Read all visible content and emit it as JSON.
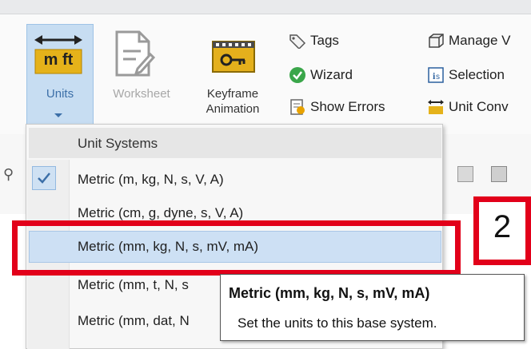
{
  "ribbon": {
    "units_label": "Units",
    "worksheet_label": "Worksheet",
    "keyframe_label_line1": "Keyframe",
    "keyframe_label_line2": "Animation",
    "units_icon_text": "m ft",
    "col2": {
      "tags": "Tags",
      "wizard": "Wizard",
      "show_errors": "Show Errors"
    },
    "col3": {
      "manage": "Manage V",
      "selection": "Selection",
      "unit_conv": "Unit Conv"
    }
  },
  "menu": {
    "header": "Unit Systems",
    "items": [
      {
        "label": "Metric (m, kg, N, s, V, A)",
        "checked": true
      },
      {
        "label": "Metric (cm, g, dyne, s, V, A)",
        "checked": false
      },
      {
        "label": "Metric (mm, kg, N, s, mV, mA)",
        "checked": false,
        "highlighted": true
      },
      {
        "label": "Metric (mm, t, N, s",
        "checked": false
      },
      {
        "label": "Metric (mm, dat, N",
        "checked": false
      }
    ]
  },
  "tooltip": {
    "title": "Metric (mm, kg, N, s, mV, mA)",
    "description": "Set the units to this base system."
  },
  "annotation": {
    "badge_number": "2",
    "color": "#e2001a"
  },
  "colors": {
    "highlight": "#cde0f4",
    "units_selected": "#c7ddf2"
  }
}
